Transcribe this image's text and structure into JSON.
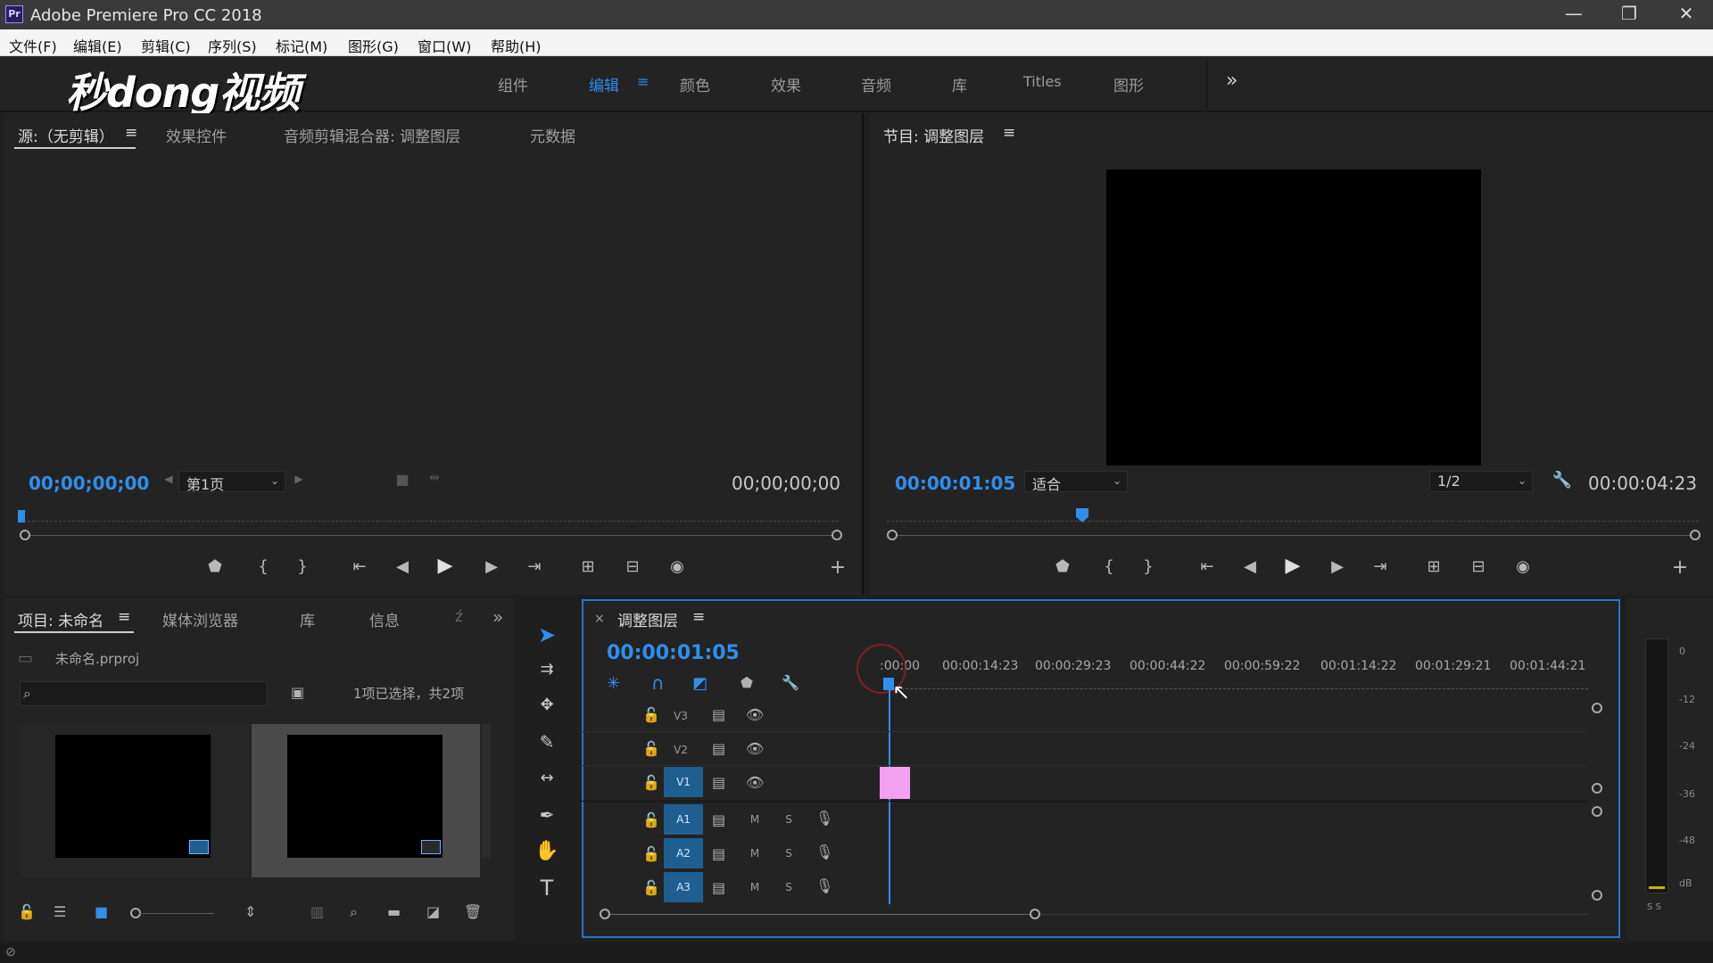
{
  "app": {
    "title": "Adobe Premiere Pro CC 2018",
    "icon": "Pr"
  },
  "window_controls": {
    "minimize": "—",
    "restore": "❐",
    "close": "✕"
  },
  "menu": [
    "文件(F)",
    "编辑(E)",
    "剪辑(C)",
    "序列(S)",
    "标记(M)",
    "图形(G)",
    "窗口(W)",
    "帮助(H)"
  ],
  "brand_overlay": "秒dong视频",
  "workspaces": {
    "tabs": [
      "组件",
      "编辑",
      "颜色",
      "效果",
      "音频",
      "库",
      "Titles",
      "图形"
    ],
    "active": "编辑",
    "overflow": "»"
  },
  "source_panel": {
    "tabs": [
      "源:（无剪辑）",
      "效果控件",
      "音频剪辑混合器: 调整图层",
      "元数据"
    ],
    "timecode_left": "00;00;00;00",
    "timecode_right": "00;00;00;00",
    "page_dropdown": "第1页"
  },
  "program_panel": {
    "title": "节目: 调整图层",
    "timecode": "00:00:01:05",
    "fit_dropdown": "适合",
    "resolution_dropdown": "1/2",
    "duration": "00:00:04:23"
  },
  "project_panel": {
    "tabs": [
      "项目: 未命名",
      "媒体浏览器",
      "库",
      "信息"
    ],
    "file": "未命名.prproj",
    "selection_status": "1项已选择，共2项"
  },
  "timeline": {
    "sequence_tab": "调整图层",
    "close": "×",
    "timecode": "00:00:01:05",
    "ruler_labels": [
      ":00:00",
      "00:00:14:23",
      "00:00:29:23",
      "00:00:44:22",
      "00:00:59:22",
      "00:01:14:22",
      "00:01:29:21",
      "00:01:44:21"
    ],
    "video_tracks": [
      "V3",
      "V2",
      "V1"
    ],
    "audio_tracks": [
      "A1",
      "A2",
      "A3"
    ],
    "mute_label": "M",
    "solo_label": "S",
    "clip_color": "#f2a0f0"
  },
  "audio_meter": {
    "scale": [
      "0",
      "-12",
      "-24",
      "-36",
      "-48",
      "dB"
    ],
    "solo_buttons": "S S"
  },
  "colors": {
    "accent_blue": "#2f8fee",
    "panel_bg": "#232323",
    "frame_black": "#000000",
    "track_blue": "#1f5f8f"
  }
}
